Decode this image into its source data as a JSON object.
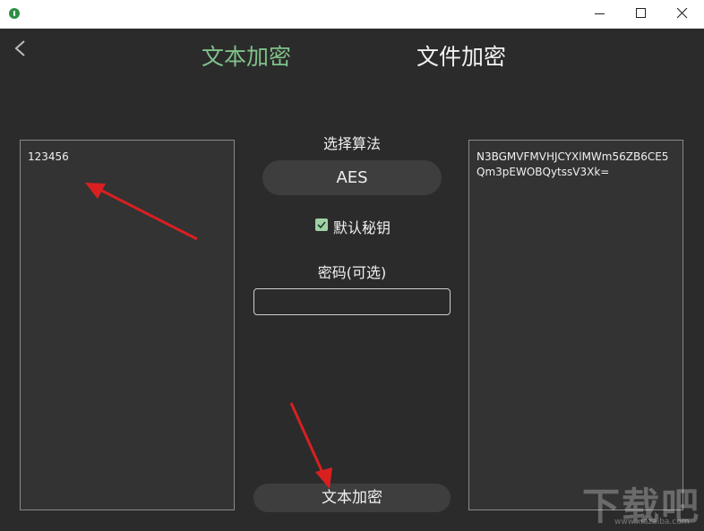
{
  "window": {
    "controls": {
      "minimize_icon": "minimize-icon",
      "maximize_icon": "maximize-icon",
      "close_icon": "close-icon"
    }
  },
  "header": {
    "back_icon": "chevron-left-icon",
    "tabs": [
      {
        "label": "文本加密",
        "active": true,
        "color": "#7fc28a"
      },
      {
        "label": "文件加密",
        "active": false
      }
    ]
  },
  "left_panel": {
    "text": "123456"
  },
  "middle": {
    "algo_label": "选择算法",
    "algo_value": "AES",
    "default_key_label": "默认秘钥",
    "default_key_checked": true,
    "password_label": "密码(可选)",
    "password_value": "",
    "encrypt_button": "文本加密"
  },
  "right_panel": {
    "text": "N3BGMVFMVHJCYXlMWm56ZB6CE5Qm3pEWOBQytssV3Xk="
  },
  "watermark": {
    "text": "下载吧",
    "sub": "www.xiazaiba.com"
  },
  "annotations": {
    "arrow_color": "#e02020"
  }
}
